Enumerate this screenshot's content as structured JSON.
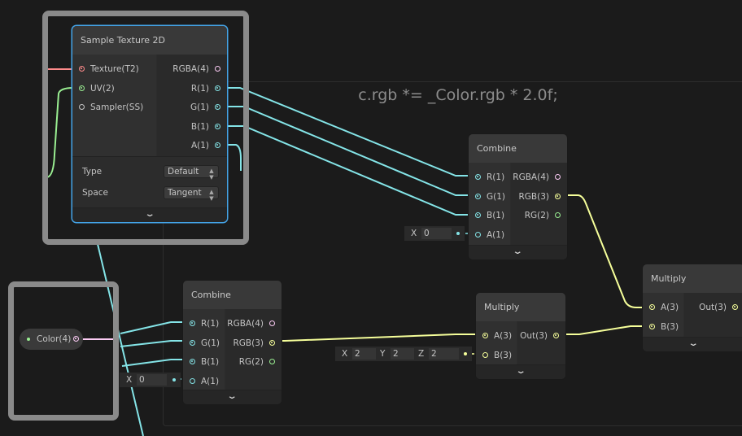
{
  "group": {
    "title": "c.rgb *= _Color.rgb * 2.0f;"
  },
  "colors": {
    "vector1": "#84e4e7",
    "vector2": "#9aef92",
    "vector3": "#f6ff9a",
    "vector4": "#fbcbf4",
    "texture": "#ff8b8b",
    "sampler": "#c6c6c6",
    "selection": "#44a4e8"
  },
  "nodes": {
    "sample_texture": {
      "title": "Sample Texture 2D",
      "inputs": [
        {
          "label": "Texture(T2)",
          "type": "texture"
        },
        {
          "label": "UV(2)",
          "type": "vector2"
        },
        {
          "label": "Sampler(SS)",
          "type": "sampler"
        }
      ],
      "outputs": [
        {
          "label": "RGBA(4)",
          "type": "vector4"
        },
        {
          "label": "R(1)",
          "type": "vector1"
        },
        {
          "label": "G(1)",
          "type": "vector1"
        },
        {
          "label": "B(1)",
          "type": "vector1"
        },
        {
          "label": "A(1)",
          "type": "vector1"
        }
      ],
      "props": [
        {
          "label": "Type",
          "value": "Default"
        },
        {
          "label": "Space",
          "value": "Tangent"
        }
      ]
    },
    "combine_top": {
      "title": "Combine",
      "inputs": [
        {
          "label": "R(1)",
          "type": "vector1"
        },
        {
          "label": "G(1)",
          "type": "vector1"
        },
        {
          "label": "B(1)",
          "type": "vector1"
        },
        {
          "label": "A(1)",
          "type": "vector1"
        }
      ],
      "outputs": [
        {
          "label": "RGBA(4)",
          "type": "vector4"
        },
        {
          "label": "RGB(3)",
          "type": "vector3"
        },
        {
          "label": "RG(2)",
          "type": "vector2"
        }
      ]
    },
    "combine_bottom": {
      "title": "Combine",
      "inputs": [
        {
          "label": "R(1)",
          "type": "vector1"
        },
        {
          "label": "G(1)",
          "type": "vector1"
        },
        {
          "label": "B(1)",
          "type": "vector1"
        },
        {
          "label": "A(1)",
          "type": "vector1"
        }
      ],
      "outputs": [
        {
          "label": "RGBA(4)",
          "type": "vector4"
        },
        {
          "label": "RGB(3)",
          "type": "vector3"
        },
        {
          "label": "RG(2)",
          "type": "vector2"
        }
      ]
    },
    "multiply_left": {
      "title": "Multiply",
      "inputs": [
        {
          "label": "A(3)",
          "type": "vector3"
        },
        {
          "label": "B(3)",
          "type": "vector3"
        }
      ],
      "outputs": [
        {
          "label": "Out(3)",
          "type": "vector3"
        }
      ]
    },
    "multiply_right": {
      "title": "Multiply",
      "inputs": [
        {
          "label": "A(3)",
          "type": "vector3"
        },
        {
          "label": "B(3)",
          "type": "vector3"
        }
      ],
      "outputs": [
        {
          "label": "Out(3)",
          "type": "vector3"
        }
      ]
    }
  },
  "property_node": {
    "label": "Color(4)"
  },
  "fields": {
    "combine_top_a": [
      {
        "axis": "X",
        "value": "0"
      }
    ],
    "combine_bottom_a": [
      {
        "axis": "X",
        "value": "0"
      }
    ],
    "multiply_left_b": [
      {
        "axis": "X",
        "value": "2"
      },
      {
        "axis": "Y",
        "value": "2"
      },
      {
        "axis": "Z",
        "value": "2"
      }
    ]
  },
  "icons": {
    "expand": "chevron-down-icon",
    "dropdown": "updown-arrows-icon"
  }
}
